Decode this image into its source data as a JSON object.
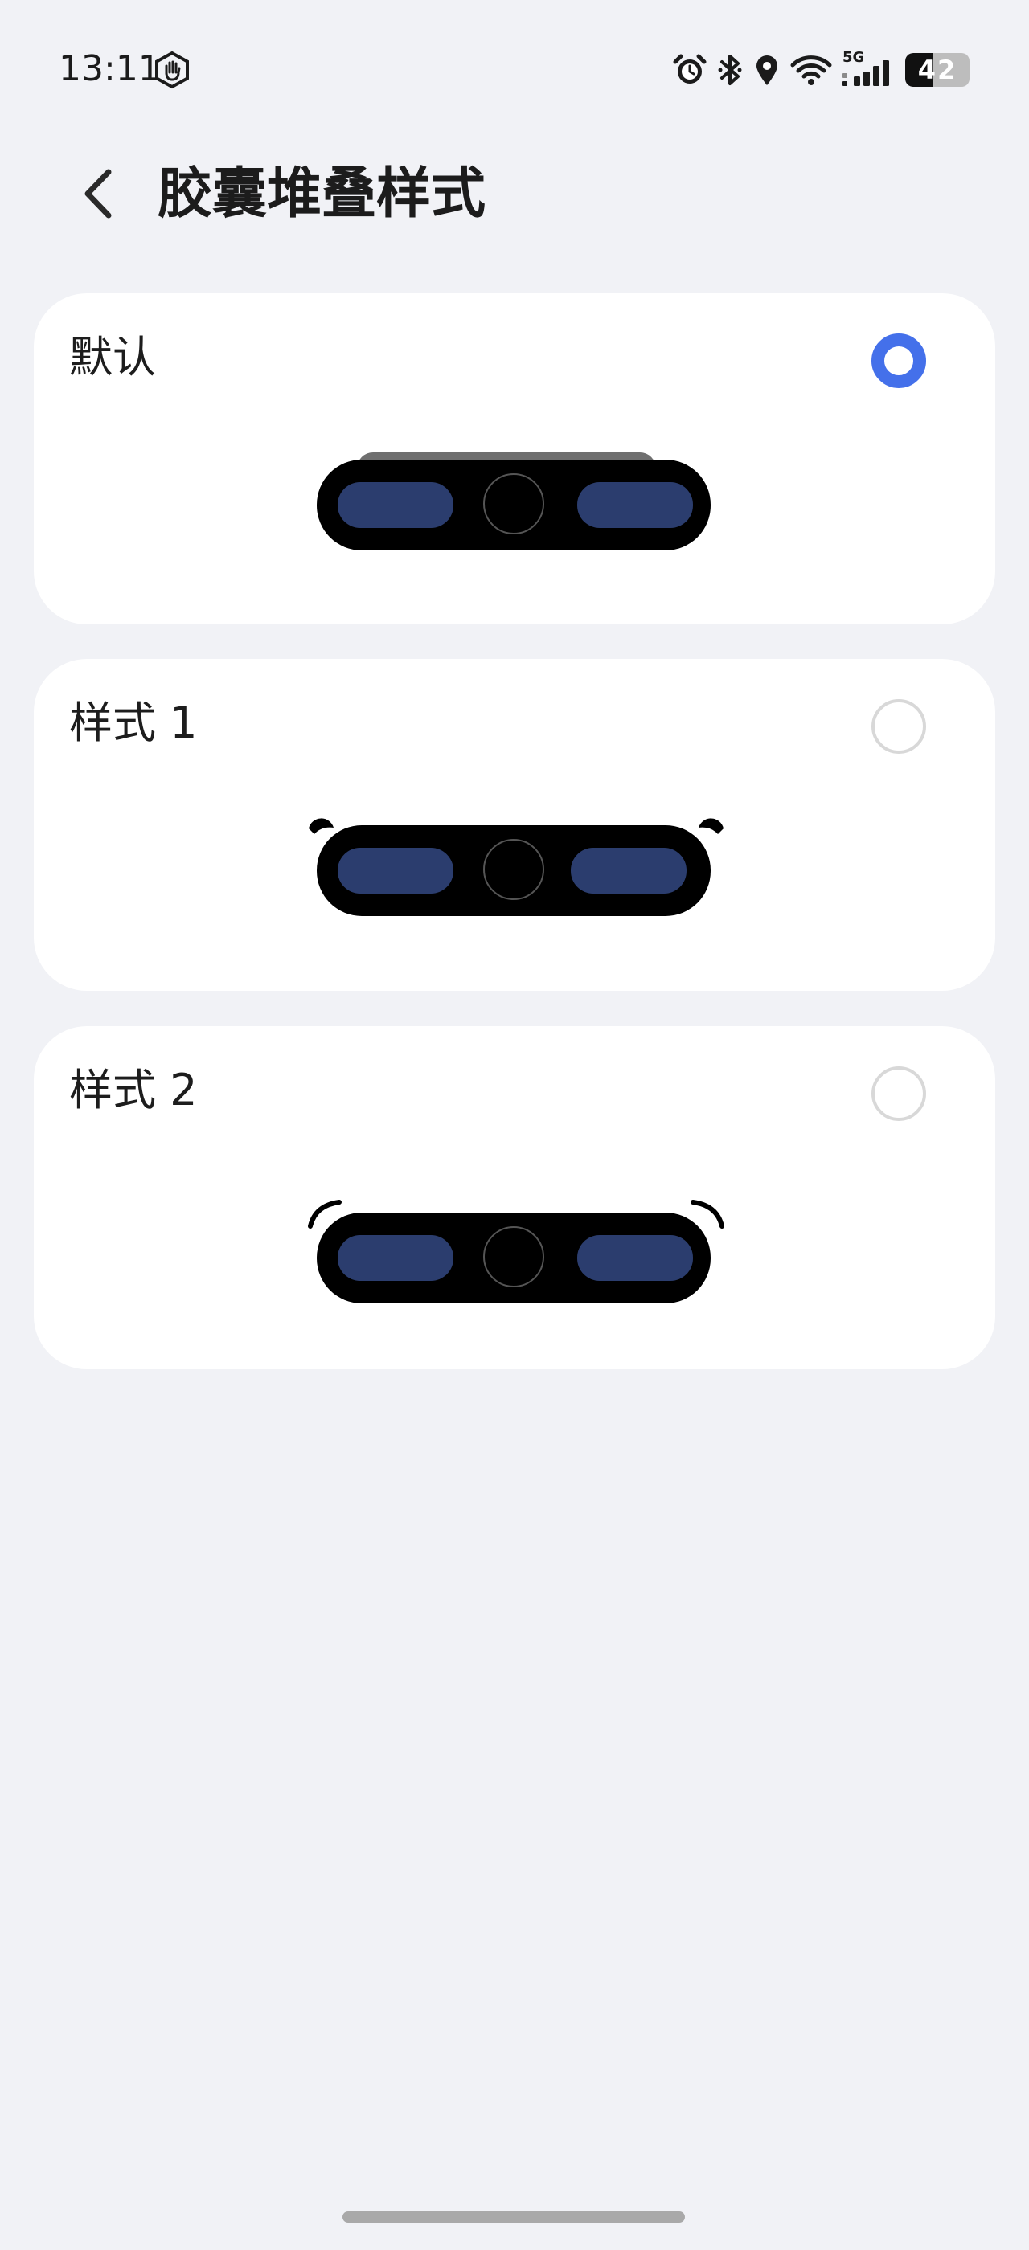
{
  "status_bar": {
    "time": "13:11",
    "network_label": "5G",
    "battery_level": "42",
    "battery_fraction": 0.42,
    "icons": [
      "hand-badge-icon",
      "alarm-icon",
      "bluetooth-icon",
      "location-icon",
      "wifi-icon",
      "signal-icon",
      "battery-icon"
    ]
  },
  "header": {
    "back_icon": "chevron-left-icon",
    "title": "胶囊堆叠样式"
  },
  "options": [
    {
      "label": "默认",
      "selected": true
    },
    {
      "label": "样式 1",
      "selected": false
    },
    {
      "label": "样式 2",
      "selected": false
    }
  ],
  "colors": {
    "accent": "#4470ea",
    "background": "#f1f2f6",
    "card": "#ffffff",
    "capsule_body": "#000000",
    "capsule_pill": "#2b3d6e"
  }
}
